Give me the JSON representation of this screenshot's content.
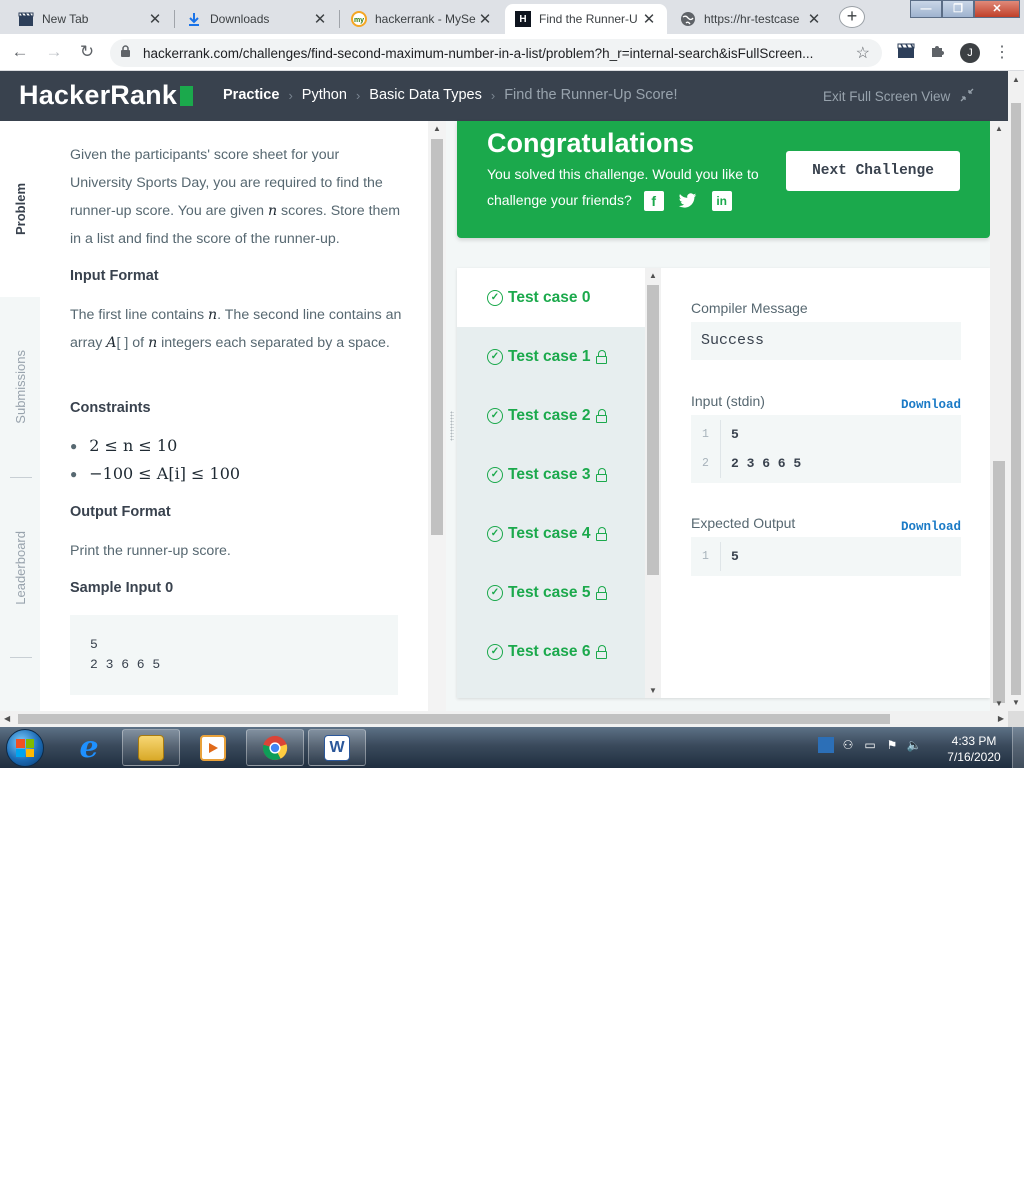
{
  "browser": {
    "tabs": [
      {
        "title": "New Tab",
        "favicon": "clapper-icon",
        "active": false
      },
      {
        "title": "Downloads",
        "favicon": "download-icon",
        "active": false
      },
      {
        "title": "hackerrank - MySe",
        "favicon": "mysearch-icon",
        "active": false
      },
      {
        "title": "Find the Runner-U",
        "favicon": "hackerrank-icon",
        "active": true
      },
      {
        "title": "https://hr-testcase",
        "favicon": "globe-icon",
        "active": false
      }
    ],
    "close_glyph": "✕",
    "new_tab": "+",
    "url": "hackerrank.com/challenges/find-second-maximum-number-in-a-list/problem?h_r=internal-search&isFullScreen...",
    "profile_initial": "J"
  },
  "header": {
    "logo": "HackerRank",
    "breadcrumb": [
      "Practice",
      "Python",
      "Basic Data Types",
      "Find the Runner-Up Score!"
    ],
    "exit_full_screen": "Exit Full Screen View"
  },
  "rail": {
    "problem": "Problem",
    "submissions": "Submissions",
    "leaderboard": "Leaderboard"
  },
  "problem": {
    "intro_before_n": "Given the participants' score sheet for your University Sports Day, you are required to find the runner-up score. You are given ",
    "var_n": "n",
    "intro_after_n": " scores. Store them in a list and find the score of the runner-up.",
    "input_heading": "Input Format",
    "input_part1": "The first line contains ",
    "input_part2": ". The second line contains an array ",
    "var_A": "A",
    "brackets": "[ ]",
    "input_part3": " of ",
    "input_part4": " integers each separated by a space.",
    "constraints_heading": "Constraints",
    "constraints": [
      "2 ≤ n ≤ 10",
      "−100 ≤ A[i] ≤ 100"
    ],
    "output_heading": "Output Format",
    "output_text": "Print the runner-up score.",
    "sample_heading": "Sample Input 0",
    "sample_lines": [
      "5",
      "2 3 6 6 5"
    ]
  },
  "congrats": {
    "title": "Congratulations",
    "message": "You solved this challenge. Would you like to challenge your friends?",
    "share": [
      "facebook-icon",
      "twitter-icon",
      "linkedin-icon"
    ],
    "next_button": "Next Challenge"
  },
  "test_cases": [
    {
      "label": "Test case 0",
      "locked": false,
      "active": true
    },
    {
      "label": "Test case 1",
      "locked": true,
      "active": false
    },
    {
      "label": "Test case 2",
      "locked": true,
      "active": false
    },
    {
      "label": "Test case 3",
      "locked": true,
      "active": false
    },
    {
      "label": "Test case 4",
      "locked": true,
      "active": false
    },
    {
      "label": "Test case 5",
      "locked": true,
      "active": false
    },
    {
      "label": "Test case 6",
      "locked": true,
      "active": false
    }
  ],
  "detail": {
    "compiler_label": "Compiler Message",
    "compiler_message": "Success",
    "input_label": "Input (stdin)",
    "download": "Download",
    "input_lines": [
      {
        "num": "1",
        "text": "5"
      },
      {
        "num": "2",
        "text": "2 3 6 6 5"
      }
    ],
    "expected_label": "Expected Output",
    "expected_lines": [
      {
        "num": "1",
        "text": "5"
      }
    ]
  },
  "taskbar": {
    "time": "4:33 PM",
    "date": "7/16/2020"
  },
  "colors": {
    "brand_green": "#1ba94c",
    "header_dark": "#39424e",
    "link_blue": "#1a7ac6"
  }
}
